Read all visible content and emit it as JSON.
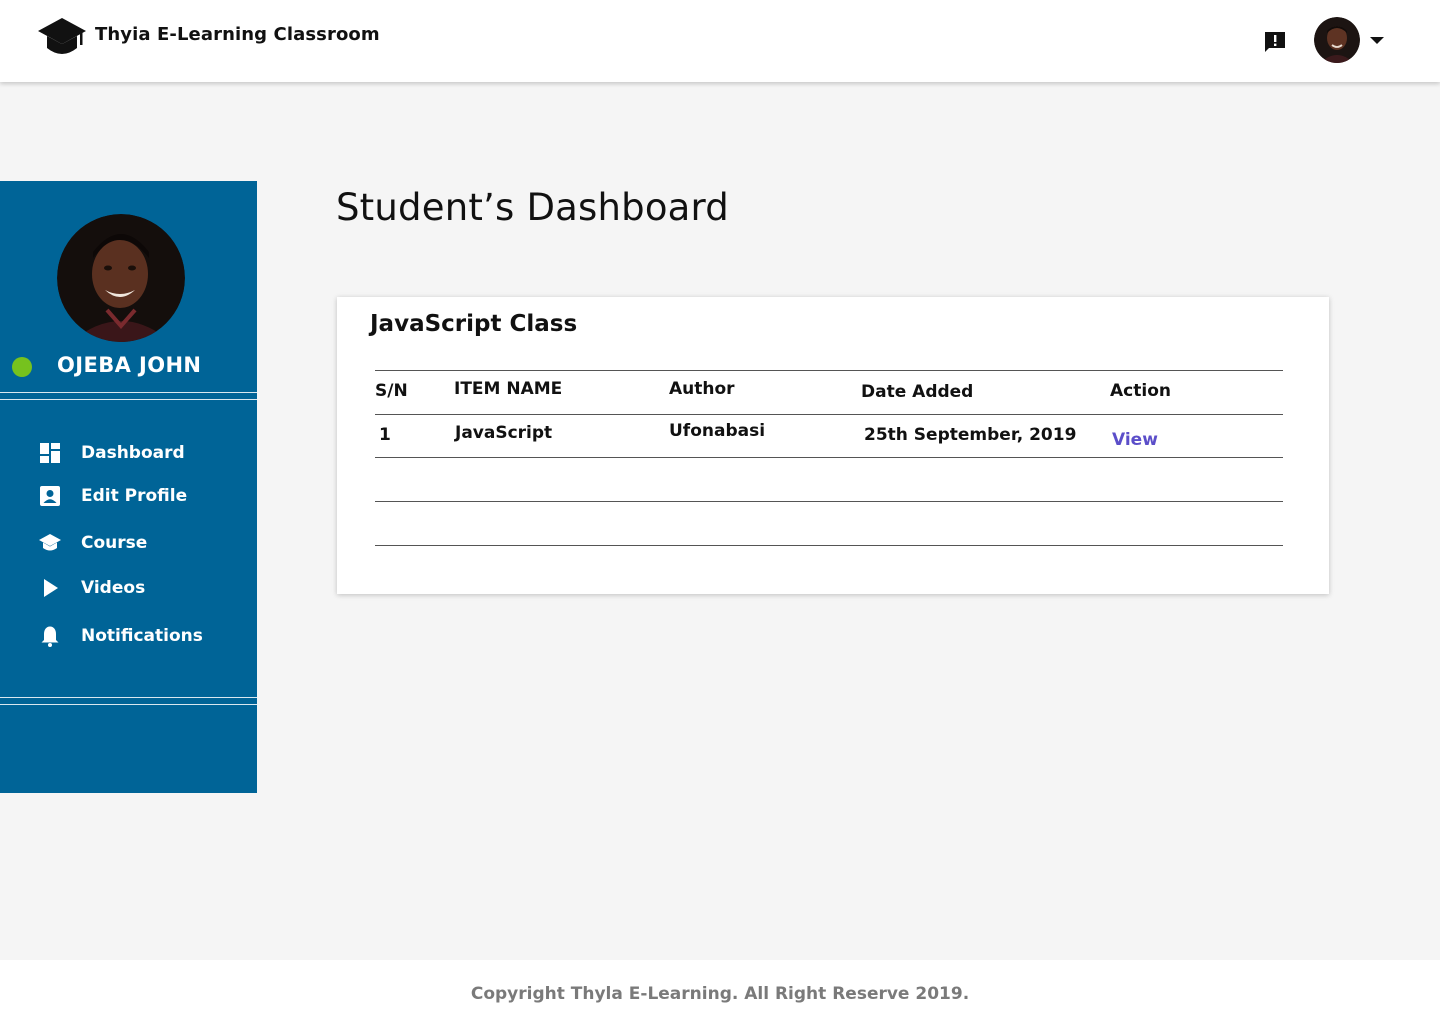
{
  "header": {
    "brand": "Thyia E-Learning Classroom"
  },
  "sidebar": {
    "user_name": "OJEBA JOHN",
    "status": "online",
    "items": [
      {
        "label": "Dashboard",
        "icon": "dashboard-icon"
      },
      {
        "label": "Edit Profile",
        "icon": "profile-card-icon"
      },
      {
        "label": "Course",
        "icon": "graduation-cap-icon"
      },
      {
        "label": "Videos",
        "icon": "play-icon"
      },
      {
        "label": "Notifications",
        "icon": "bell-icon"
      }
    ]
  },
  "main": {
    "title": "Student’s Dashboard",
    "card": {
      "title": "JavaScript Class",
      "columns": [
        "S/N",
        "ITEM NAME",
        "Author",
        "Date Added",
        "Action"
      ],
      "rows": [
        {
          "sn": "1",
          "item": "JavaScript",
          "author": "Ufonabasi",
          "date": "25th September, 2019",
          "action": "View"
        }
      ]
    }
  },
  "footer": {
    "text": "Copyright Thyla E-Learning. All Right Reserve 2019."
  },
  "colors": {
    "sidebar": "#006497",
    "online": "#76c21e",
    "link": "#5b4ec9",
    "background": "#f5f5f5"
  }
}
